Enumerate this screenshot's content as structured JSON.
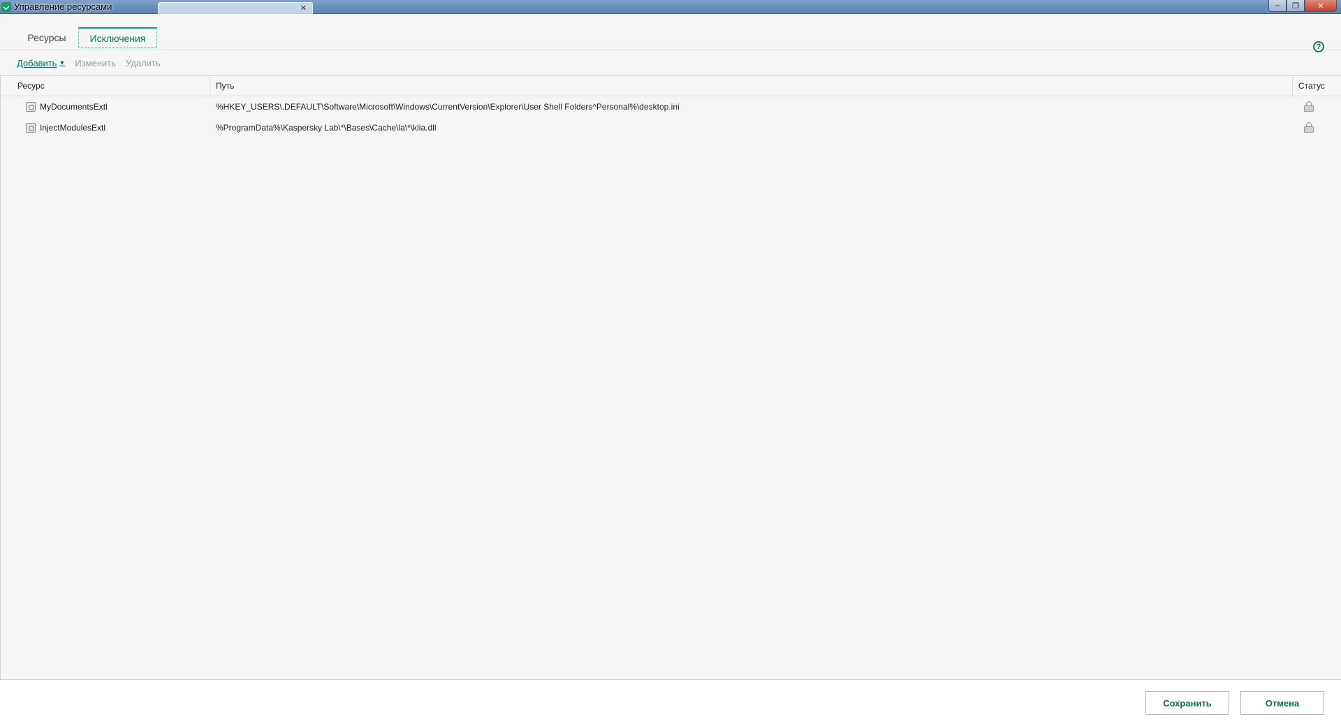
{
  "window": {
    "title": "Управление ресурсами"
  },
  "tabs": [
    {
      "label": "Ресурсы",
      "active": false
    },
    {
      "label": "Исключения",
      "active": true
    }
  ],
  "toolbar": {
    "add_label": "Добавить",
    "edit_label": "Изменить",
    "delete_label": "Удалить"
  },
  "table": {
    "columns": [
      "Ресурс",
      "Путь",
      "Статус"
    ],
    "rows": [
      {
        "resource": "MyDocumentsExtl",
        "path": "%HKEY_USERS\\.DEFAULT\\Software\\Microsoft\\Windows\\CurrentVersion\\Explorer\\User Shell Folders^Personal%\\desktop.ini",
        "status_icon": "lock-icon"
      },
      {
        "resource": "InjectModulesExtl",
        "path": "%ProgramData%\\Kaspersky Lab\\*\\Bases\\Cache\\la\\*\\klia.dll",
        "status_icon": "lock-icon"
      }
    ]
  },
  "footer": {
    "save_label": "Сохранить",
    "cancel_label": "Отмена"
  },
  "colors": {
    "accent": "#00795a",
    "titlebar": "#6d93bd",
    "disabled_text": "#9a9a9a"
  }
}
